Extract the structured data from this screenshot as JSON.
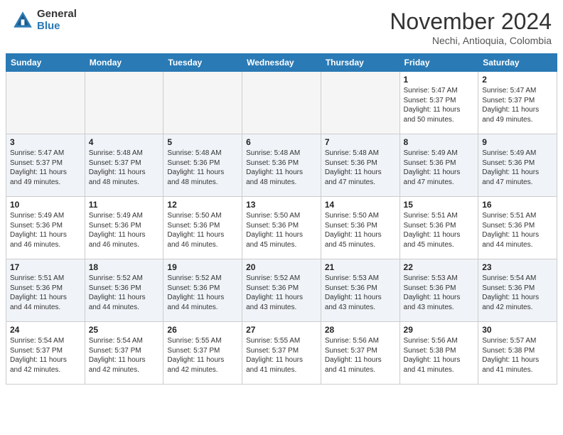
{
  "header": {
    "logo_general": "General",
    "logo_blue": "Blue",
    "month_title": "November 2024",
    "location": "Nechi, Antioquia, Colombia"
  },
  "weekdays": [
    "Sunday",
    "Monday",
    "Tuesday",
    "Wednesday",
    "Thursday",
    "Friday",
    "Saturday"
  ],
  "weeks": [
    [
      {
        "day": "",
        "info": ""
      },
      {
        "day": "",
        "info": ""
      },
      {
        "day": "",
        "info": ""
      },
      {
        "day": "",
        "info": ""
      },
      {
        "day": "",
        "info": ""
      },
      {
        "day": "1",
        "info": "Sunrise: 5:47 AM\nSunset: 5:37 PM\nDaylight: 11 hours\nand 50 minutes."
      },
      {
        "day": "2",
        "info": "Sunrise: 5:47 AM\nSunset: 5:37 PM\nDaylight: 11 hours\nand 49 minutes."
      }
    ],
    [
      {
        "day": "3",
        "info": "Sunrise: 5:47 AM\nSunset: 5:37 PM\nDaylight: 11 hours\nand 49 minutes."
      },
      {
        "day": "4",
        "info": "Sunrise: 5:48 AM\nSunset: 5:37 PM\nDaylight: 11 hours\nand 48 minutes."
      },
      {
        "day": "5",
        "info": "Sunrise: 5:48 AM\nSunset: 5:36 PM\nDaylight: 11 hours\nand 48 minutes."
      },
      {
        "day": "6",
        "info": "Sunrise: 5:48 AM\nSunset: 5:36 PM\nDaylight: 11 hours\nand 48 minutes."
      },
      {
        "day": "7",
        "info": "Sunrise: 5:48 AM\nSunset: 5:36 PM\nDaylight: 11 hours\nand 47 minutes."
      },
      {
        "day": "8",
        "info": "Sunrise: 5:49 AM\nSunset: 5:36 PM\nDaylight: 11 hours\nand 47 minutes."
      },
      {
        "day": "9",
        "info": "Sunrise: 5:49 AM\nSunset: 5:36 PM\nDaylight: 11 hours\nand 47 minutes."
      }
    ],
    [
      {
        "day": "10",
        "info": "Sunrise: 5:49 AM\nSunset: 5:36 PM\nDaylight: 11 hours\nand 46 minutes."
      },
      {
        "day": "11",
        "info": "Sunrise: 5:49 AM\nSunset: 5:36 PM\nDaylight: 11 hours\nand 46 minutes."
      },
      {
        "day": "12",
        "info": "Sunrise: 5:50 AM\nSunset: 5:36 PM\nDaylight: 11 hours\nand 46 minutes."
      },
      {
        "day": "13",
        "info": "Sunrise: 5:50 AM\nSunset: 5:36 PM\nDaylight: 11 hours\nand 45 minutes."
      },
      {
        "day": "14",
        "info": "Sunrise: 5:50 AM\nSunset: 5:36 PM\nDaylight: 11 hours\nand 45 minutes."
      },
      {
        "day": "15",
        "info": "Sunrise: 5:51 AM\nSunset: 5:36 PM\nDaylight: 11 hours\nand 45 minutes."
      },
      {
        "day": "16",
        "info": "Sunrise: 5:51 AM\nSunset: 5:36 PM\nDaylight: 11 hours\nand 44 minutes."
      }
    ],
    [
      {
        "day": "17",
        "info": "Sunrise: 5:51 AM\nSunset: 5:36 PM\nDaylight: 11 hours\nand 44 minutes."
      },
      {
        "day": "18",
        "info": "Sunrise: 5:52 AM\nSunset: 5:36 PM\nDaylight: 11 hours\nand 44 minutes."
      },
      {
        "day": "19",
        "info": "Sunrise: 5:52 AM\nSunset: 5:36 PM\nDaylight: 11 hours\nand 44 minutes."
      },
      {
        "day": "20",
        "info": "Sunrise: 5:52 AM\nSunset: 5:36 PM\nDaylight: 11 hours\nand 43 minutes."
      },
      {
        "day": "21",
        "info": "Sunrise: 5:53 AM\nSunset: 5:36 PM\nDaylight: 11 hours\nand 43 minutes."
      },
      {
        "day": "22",
        "info": "Sunrise: 5:53 AM\nSunset: 5:36 PM\nDaylight: 11 hours\nand 43 minutes."
      },
      {
        "day": "23",
        "info": "Sunrise: 5:54 AM\nSunset: 5:36 PM\nDaylight: 11 hours\nand 42 minutes."
      }
    ],
    [
      {
        "day": "24",
        "info": "Sunrise: 5:54 AM\nSunset: 5:37 PM\nDaylight: 11 hours\nand 42 minutes."
      },
      {
        "day": "25",
        "info": "Sunrise: 5:54 AM\nSunset: 5:37 PM\nDaylight: 11 hours\nand 42 minutes."
      },
      {
        "day": "26",
        "info": "Sunrise: 5:55 AM\nSunset: 5:37 PM\nDaylight: 11 hours\nand 42 minutes."
      },
      {
        "day": "27",
        "info": "Sunrise: 5:55 AM\nSunset: 5:37 PM\nDaylight: 11 hours\nand 41 minutes."
      },
      {
        "day": "28",
        "info": "Sunrise: 5:56 AM\nSunset: 5:37 PM\nDaylight: 11 hours\nand 41 minutes."
      },
      {
        "day": "29",
        "info": "Sunrise: 5:56 AM\nSunset: 5:38 PM\nDaylight: 11 hours\nand 41 minutes."
      },
      {
        "day": "30",
        "info": "Sunrise: 5:57 AM\nSunset: 5:38 PM\nDaylight: 11 hours\nand 41 minutes."
      }
    ]
  ]
}
